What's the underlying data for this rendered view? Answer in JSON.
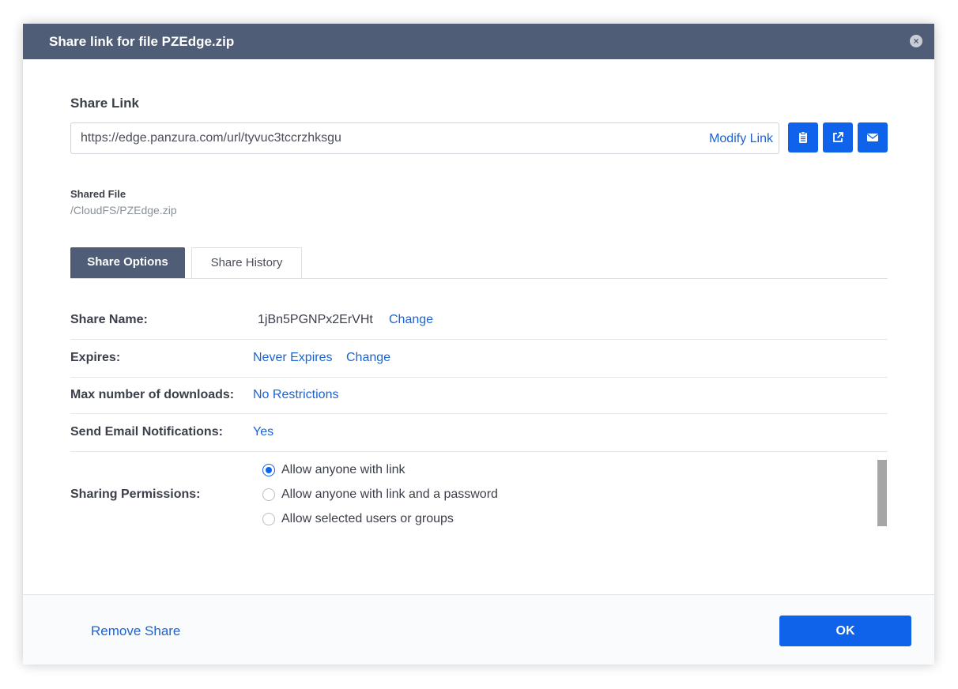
{
  "dialog": {
    "title": "Share link for file PZEdge.zip",
    "close_icon": "close-icon"
  },
  "share_link": {
    "label": "Share Link",
    "url": "https://edge.panzura.com/url/tyvuc3tccrzhksgu",
    "modify_label": "Modify Link",
    "buttons": [
      {
        "icon": "clipboard-icon"
      },
      {
        "icon": "external-link-icon"
      },
      {
        "icon": "envelope-icon"
      }
    ]
  },
  "shared_file": {
    "label": "Shared File",
    "path": "/CloudFS/PZEdge.zip"
  },
  "tabs": [
    {
      "label": "Share Options",
      "active": true
    },
    {
      "label": "Share History",
      "active": false
    }
  ],
  "options": {
    "share_name": {
      "label": "Share Name:",
      "value": "1jBn5PGNPx2ErVHt",
      "action": "Change"
    },
    "expires": {
      "label": "Expires:",
      "value": "Never Expires",
      "action": "Change"
    },
    "max_downloads": {
      "label": "Max number of downloads:",
      "value": "No Restrictions"
    },
    "email_notifications": {
      "label": "Send Email Notifications:",
      "value": "Yes"
    },
    "permissions": {
      "label": "Sharing Permissions:",
      "choices": [
        {
          "label": "Allow anyone with link",
          "selected": true
        },
        {
          "label": "Allow anyone with link and a password",
          "selected": false
        },
        {
          "label": "Allow selected users or groups",
          "selected": false
        }
      ]
    }
  },
  "footer": {
    "remove_label": "Remove Share",
    "ok_label": "OK"
  },
  "colors": {
    "titlebar": "#4f5d77",
    "accent": "#0e63ea",
    "link": "#1d63cf"
  }
}
